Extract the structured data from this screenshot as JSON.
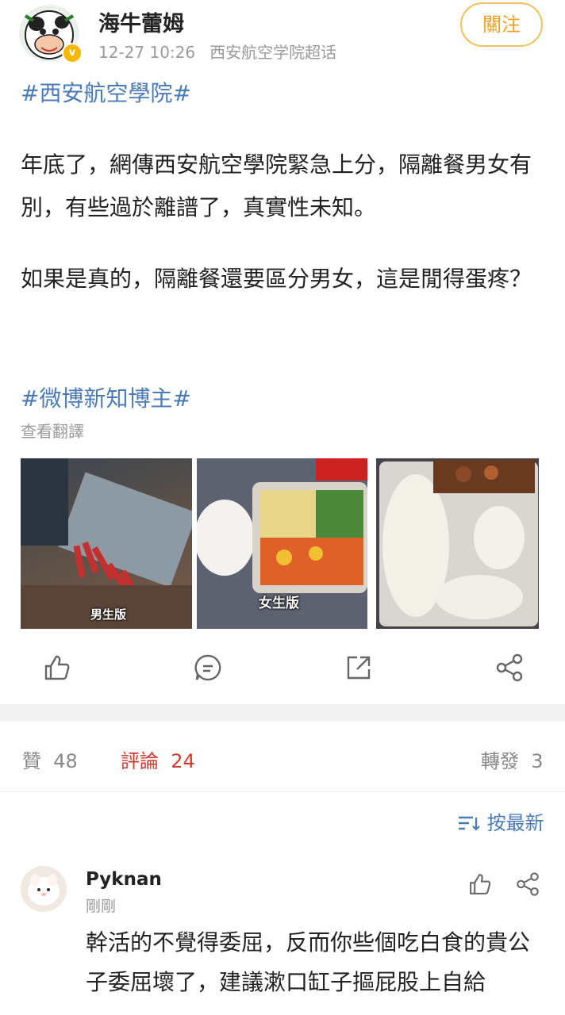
{
  "post": {
    "username": "海牛蕾姆",
    "time": "12-27 10:26",
    "source": "西安航空学院超话",
    "follow_label": "關注",
    "hashtag_top": "#西安航空學院#",
    "paragraph_1": "年底了，網傳西安航空學院緊急上分，隔離餐男女有別，有些過於離譜了，真實性未知。",
    "paragraph_2": "如果是真的，隔離餐還要區分男女，這是閒得蛋疼？",
    "hashtag_bottom": "#微博新知博主#",
    "translate_label": "查看翻譯",
    "images": [
      {
        "caption": "男生版"
      },
      {
        "caption": "女生版"
      },
      {
        "caption": ""
      }
    ]
  },
  "actions": {
    "like_icon": "thumbs-up-icon",
    "comment_icon": "comment-icon",
    "repost_icon": "repost-icon",
    "share_icon": "share-icon"
  },
  "stats": {
    "likes_label": "贊",
    "likes_count": "48",
    "comments_label": "評論",
    "comments_count": "24",
    "reposts_label": "轉發",
    "reposts_count": "3"
  },
  "sort": {
    "label": "按最新",
    "icon": "sort-icon"
  },
  "comment": {
    "username": "Pyknan",
    "time": "剛剛",
    "text": "幹活的不覺得委屈，反而你些個吃白食的貴公子委屈壞了，建議漱口缸子摳屁股上自給"
  },
  "colors": {
    "link_blue": "#4a7bb8",
    "active_red": "#d33a2f",
    "follow_orange": "#f0a020"
  }
}
